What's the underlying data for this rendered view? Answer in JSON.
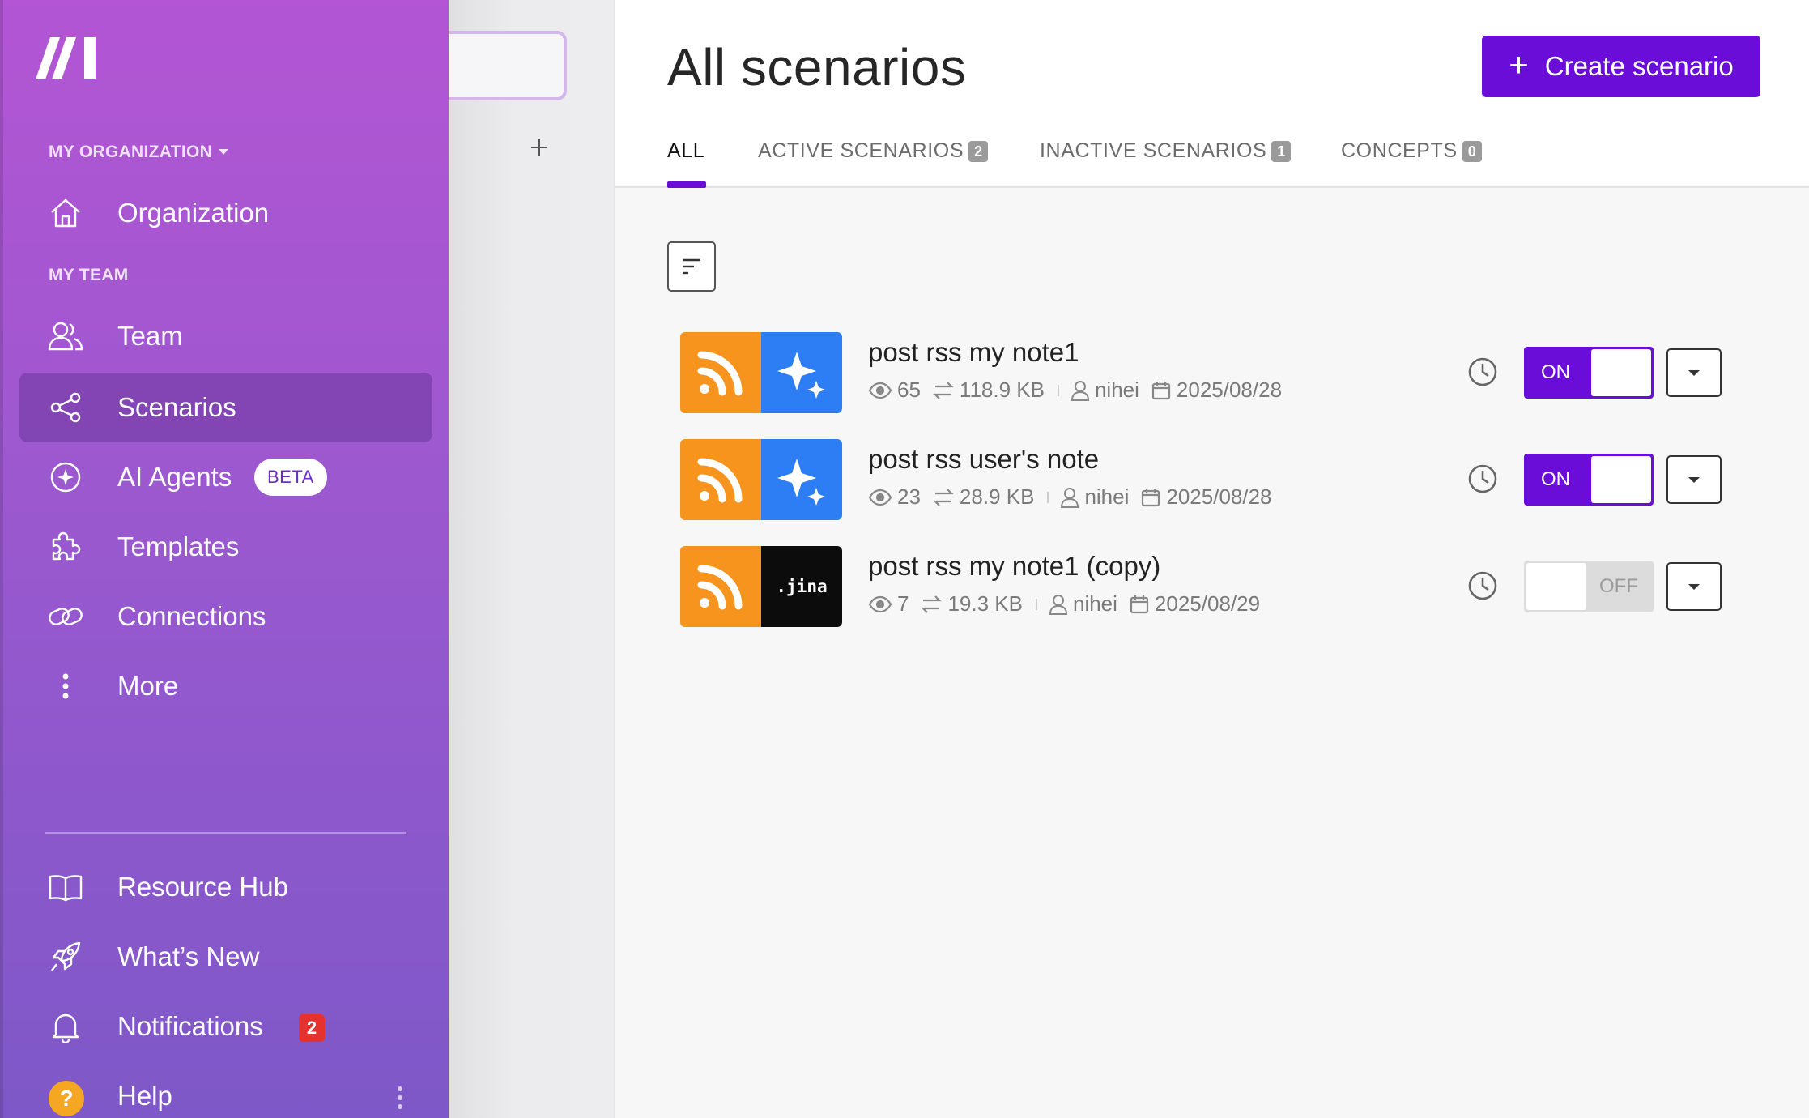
{
  "sidebar": {
    "org_section": "MY ORGANIZATION",
    "team_section": "MY TEAM",
    "items": {
      "organization": "Organization",
      "team": "Team",
      "scenarios": "Scenarios",
      "ai_agents": "AI Agents",
      "ai_agents_badge": "BETA",
      "templates": "Templates",
      "connections": "Connections",
      "more": "More",
      "resource_hub": "Resource Hub",
      "whats_new": "What’s New",
      "notifications": "Notifications",
      "notifications_count": "2",
      "help": "Help",
      "help_icon": "?"
    }
  },
  "header": {
    "title": "All scenarios",
    "create_button": "Create scenario",
    "create_icon": "+"
  },
  "tabs": [
    {
      "label": "ALL",
      "count": ""
    },
    {
      "label": "ACTIVE SCENARIOS",
      "count": "2"
    },
    {
      "label": "INACTIVE SCENARIOS",
      "count": "1"
    },
    {
      "label": "CONCEPTS",
      "count": "0"
    }
  ],
  "scenarios": [
    {
      "name": "post rss my note1",
      "ops": "65",
      "data": "118.9 KB",
      "owner": "nihei",
      "date": "2025/08/28",
      "status": "ON",
      "apps": [
        "rss",
        "ai-sparkle"
      ]
    },
    {
      "name": "post rss user's note",
      "ops": "23",
      "data": "28.9 KB",
      "owner": "nihei",
      "date": "2025/08/28",
      "status": "ON",
      "apps": [
        "rss",
        "ai-sparkle"
      ]
    },
    {
      "name": "post rss my note1 (copy)",
      "ops": "7",
      "data": "19.3 KB",
      "owner": "nihei",
      "date": "2025/08/29",
      "status": "OFF",
      "apps": [
        "rss",
        "jina"
      ],
      "jina_label": ".jina"
    }
  ],
  "colors": {
    "brand": "#6a0dd8",
    "sidebar_top": "#b355d4",
    "sidebar_bottom": "#7e58c8",
    "rss": "#f7941d",
    "ai": "#2d7df5",
    "badge_red": "#e6322e"
  }
}
